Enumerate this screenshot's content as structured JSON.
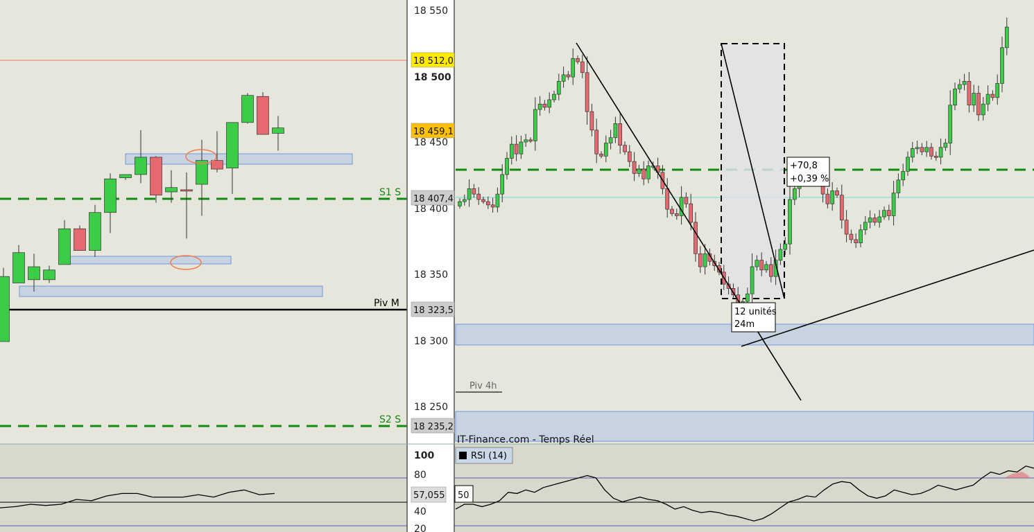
{
  "colors": {
    "background": "#e7e6dc",
    "up": "#3dcc47",
    "down": "#e56a6f",
    "pivot": "#000000",
    "support": "#118a11",
    "resistance": "#f28878",
    "zone_fill": "#c8d3e2",
    "zone_border": "#6f97dd",
    "cyan": "#7fe0e0",
    "tag_yellow": "#ffea00",
    "tag_orange": "#ffc107",
    "tag_gray": "#cccccc"
  },
  "chart_data": [
    {
      "type": "candlestick",
      "panel": "left",
      "ylim": [
        18202,
        18568
      ],
      "candles": [
        {
          "o": 18262,
          "h": 18330,
          "l": 18262,
          "c": 18322
        },
        {
          "o": 18316,
          "h": 18351,
          "l": 18316,
          "c": 18344
        },
        {
          "o": 18319,
          "h": 18343,
          "l": 18308,
          "c": 18331
        },
        {
          "o": 18319,
          "h": 18332,
          "l": 18316,
          "c": 18328
        },
        {
          "o": 18333,
          "h": 18374,
          "l": 18333,
          "c": 18366
        },
        {
          "o": 18366,
          "h": 18369,
          "l": 18346,
          "c": 18346
        },
        {
          "o": 18346,
          "h": 18388,
          "l": 18340,
          "c": 18381
        },
        {
          "o": 18381,
          "h": 18417,
          "l": 18362,
          "c": 18412
        },
        {
          "o": 18413,
          "h": 18416,
          "l": 18411,
          "c": 18416
        },
        {
          "o": 18416,
          "h": 18457,
          "l": 18408,
          "c": 18432
        },
        {
          "o": 18432,
          "h": 18433,
          "l": 18390,
          "c": 18397
        },
        {
          "o": 18400,
          "h": 18420,
          "l": 18390,
          "c": 18404
        },
        {
          "o": 18402,
          "h": 18418,
          "l": 18357,
          "c": 18401
        },
        {
          "o": 18407,
          "h": 18448,
          "l": 18378,
          "c": 18429
        },
        {
          "o": 18429,
          "h": 18456,
          "l": 18418,
          "c": 18421
        },
        {
          "o": 18422,
          "h": 18461,
          "l": 18398,
          "c": 18464
        },
        {
          "o": 18464,
          "h": 18491,
          "l": 18463,
          "c": 18489
        },
        {
          "o": 18488,
          "h": 18492,
          "l": 18454,
          "c": 18453
        },
        {
          "o": 18454,
          "h": 18470,
          "l": 18438,
          "c": 18459
        }
      ],
      "price_tags": [
        "18 512,0",
        "18 459,1",
        "18 407,4",
        "18 323,5",
        "18 235,2"
      ],
      "levels": [
        "S1 S",
        "Piv M",
        "S2 S"
      ],
      "y_ticks": [
        "18 550",
        "18 500",
        "18 450",
        "18 400",
        "18 350",
        "18 300",
        "18 250"
      ]
    },
    {
      "type": "candlestick",
      "panel": "right",
      "ylim": [
        18202,
        18568
      ],
      "closes": [
        18391,
        18393,
        18403,
        18398,
        18393,
        18391,
        18388,
        18386,
        18398,
        18416,
        18431,
        18444,
        18435,
        18446,
        18448,
        18447,
        18476,
        18481,
        18478,
        18485,
        18490,
        18502,
        18508,
        18506,
        18523,
        18520,
        18510,
        18474,
        18457,
        18435,
        18433,
        18445,
        18450,
        18463,
        18443,
        18437,
        18428,
        18417,
        18421,
        18412,
        18424,
        18424,
        18418,
        18403,
        18384,
        18380,
        18378,
        18395,
        18389,
        18372,
        18343,
        18331,
        18343,
        18336,
        18332,
        18326,
        18315,
        18311,
        18305,
        18296,
        18299,
        18306,
        18331,
        18337,
        18328,
        18333,
        18322,
        18337,
        18347,
        18352,
        18393,
        18403,
        18419,
        18425,
        18425,
        18416,
        18413,
        18398,
        18389,
        18401,
        18397,
        18374,
        18361,
        18356,
        18353,
        18365,
        18372,
        18376,
        18372,
        18377,
        18383,
        18378,
        18399,
        18411,
        18419,
        18432,
        18440,
        18441,
        18437,
        18441,
        18433,
        18432,
        18441,
        18445,
        18480,
        18495,
        18499,
        18502,
        18480,
        18491,
        18471,
        18481,
        18490,
        18487,
        18500,
        18533,
        18552
      ],
      "annotations": [
        "12 unités",
        "24m",
        "+70,8",
        "+0,39 %",
        "Piv 4h"
      ],
      "source": "IT-Finance.com - Temps Réel"
    },
    {
      "type": "line",
      "panel": "rsi",
      "legend": "RSI (14)",
      "ylim": [
        20,
        100
      ],
      "y_ticks": [
        "100",
        "80",
        "40",
        "20"
      ],
      "current": "57,055",
      "level_label": "50",
      "left_values": [
        45,
        46,
        48,
        47,
        48,
        52,
        51,
        55,
        57,
        57,
        54,
        54,
        54,
        56,
        54,
        58,
        60,
        56,
        57
      ],
      "right_values": [
        44,
        48,
        48,
        46,
        48,
        51,
        58,
        57,
        60,
        58,
        62,
        64,
        66,
        68,
        70,
        72,
        70,
        60,
        53,
        50,
        52,
        54,
        52,
        51,
        48,
        44,
        46,
        43,
        41,
        42,
        41,
        39,
        38,
        36,
        34,
        36,
        40,
        45,
        50,
        52,
        55,
        54,
        60,
        65,
        67,
        66,
        60,
        55,
        53,
        55,
        60,
        58,
        56,
        57,
        60,
        64,
        62,
        60,
        62,
        64,
        70,
        75,
        73,
        76,
        75,
        80,
        78
      ]
    }
  ]
}
